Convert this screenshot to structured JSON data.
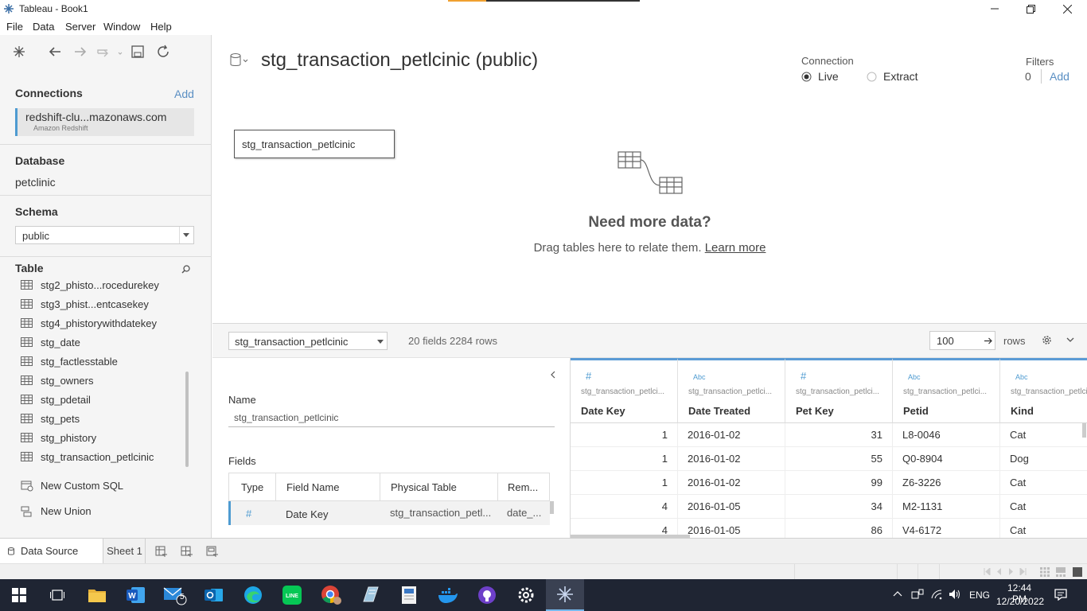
{
  "window": {
    "title": "Tableau - Book1"
  },
  "menu": [
    "File",
    "Data",
    "Server",
    "Window",
    "Help"
  ],
  "left": {
    "connections_label": "Connections",
    "add_label": "Add",
    "connection_name": "redshift-clu...mazonaws.com",
    "connection_type": "Amazon Redshift",
    "database_label": "Database",
    "database_value": "petclinic",
    "schema_label": "Schema",
    "schema_value": "public",
    "table_label": "Table",
    "tables": [
      "stg2_phisto...rocedurekey",
      "stg3_phist...entcasekey",
      "stg4_phistorywithdatekey",
      "stg_date",
      "stg_factlesstable",
      "stg_owners",
      "stg_pdetail",
      "stg_pets",
      "stg_phistory",
      "stg_transaction_petlcinic"
    ],
    "new_custom_sql": "New Custom SQL",
    "new_union": "New Union"
  },
  "main": {
    "datasource_title": "stg_transaction_petlcinic (public)",
    "connection_label": "Connection",
    "live_label": "Live",
    "extract_label": "Extract",
    "filters_label": "Filters",
    "filters_count": "0",
    "filters_add": "Add",
    "table_box": "stg_transaction_petlcinic",
    "need_more": "Need more data?",
    "drag_text": "Drag tables here to relate them.",
    "learn_more": "Learn more"
  },
  "gridtool": {
    "table_select": "stg_transaction_petlcinic",
    "summary": "20 fields 2284 rows",
    "rows_value": "100",
    "rows_label": "rows"
  },
  "meta": {
    "name_label": "Name",
    "name_value": "stg_transaction_petlcinic",
    "fields_label": "Fields",
    "headers": [
      "Type",
      "Field Name",
      "Physical Table",
      "Rem..."
    ],
    "row": {
      "type": "#",
      "field": "Date Key",
      "physical": "stg_transaction_petl...",
      "remote": "date_..."
    }
  },
  "grid": {
    "columns": [
      {
        "type": "#",
        "source": "stg_transaction_petlci...",
        "name": "Date Key"
      },
      {
        "type": "Abc",
        "source": "stg_transaction_petlci...",
        "name": "Date Treated"
      },
      {
        "type": "#",
        "source": "stg_transaction_petlci...",
        "name": "Pet Key"
      },
      {
        "type": "Abc",
        "source": "stg_transaction_petlci...",
        "name": "Petid"
      },
      {
        "type": "Abc",
        "source": "stg_transaction_petlci...",
        "name": "Kind"
      }
    ],
    "rows": [
      [
        "1",
        "2016-01-02",
        "31",
        "L8-0046",
        "Cat"
      ],
      [
        "1",
        "2016-01-02",
        "55",
        "Q0-8904",
        "Dog"
      ],
      [
        "1",
        "2016-01-02",
        "99",
        "Z6-3226",
        "Cat"
      ],
      [
        "4",
        "2016-01-05",
        "34",
        "M2-1131",
        "Cat"
      ],
      [
        "4",
        "2016-01-05",
        "86",
        "V4-6172",
        "Cat"
      ]
    ]
  },
  "tabs": {
    "data_source": "Data Source",
    "sheet1": "Sheet 1"
  },
  "taskbar": {
    "time": "12:44 PM",
    "date": "12/20/2022",
    "lang": "ENG",
    "mail_badge": "5"
  },
  "colors": {
    "accent": "#4e9bd1",
    "link": "#5a8fc3",
    "taskbar": "#1f2533"
  }
}
